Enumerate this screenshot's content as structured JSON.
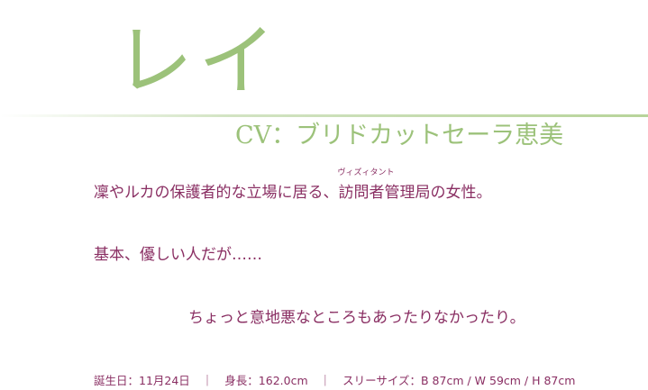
{
  "character": {
    "name": "レイ",
    "cv": "CV：ブリドカットセーラ恵美"
  },
  "description": {
    "line1_before": "凜やルカの保護者的な立場に居る、",
    "line1_ruby_base": "訪問者",
    "line1_ruby_text": "ヴィズィタント",
    "line1_after": "管理局の女性。",
    "line2": "基本、優しい人だが……",
    "line3": "ちょっと意地悪なところもあったりなかったり。"
  },
  "profile": {
    "birthday": "誕生日：11月24日",
    "separator": "｜",
    "height": "身長：162.0cm",
    "sizes": "スリーサイズ：B 87cm / W 59cm / H 87cm"
  },
  "colors": {
    "accent_green": "#9cc27a",
    "text_plum": "#8a2f63",
    "background": "#ffffff"
  }
}
